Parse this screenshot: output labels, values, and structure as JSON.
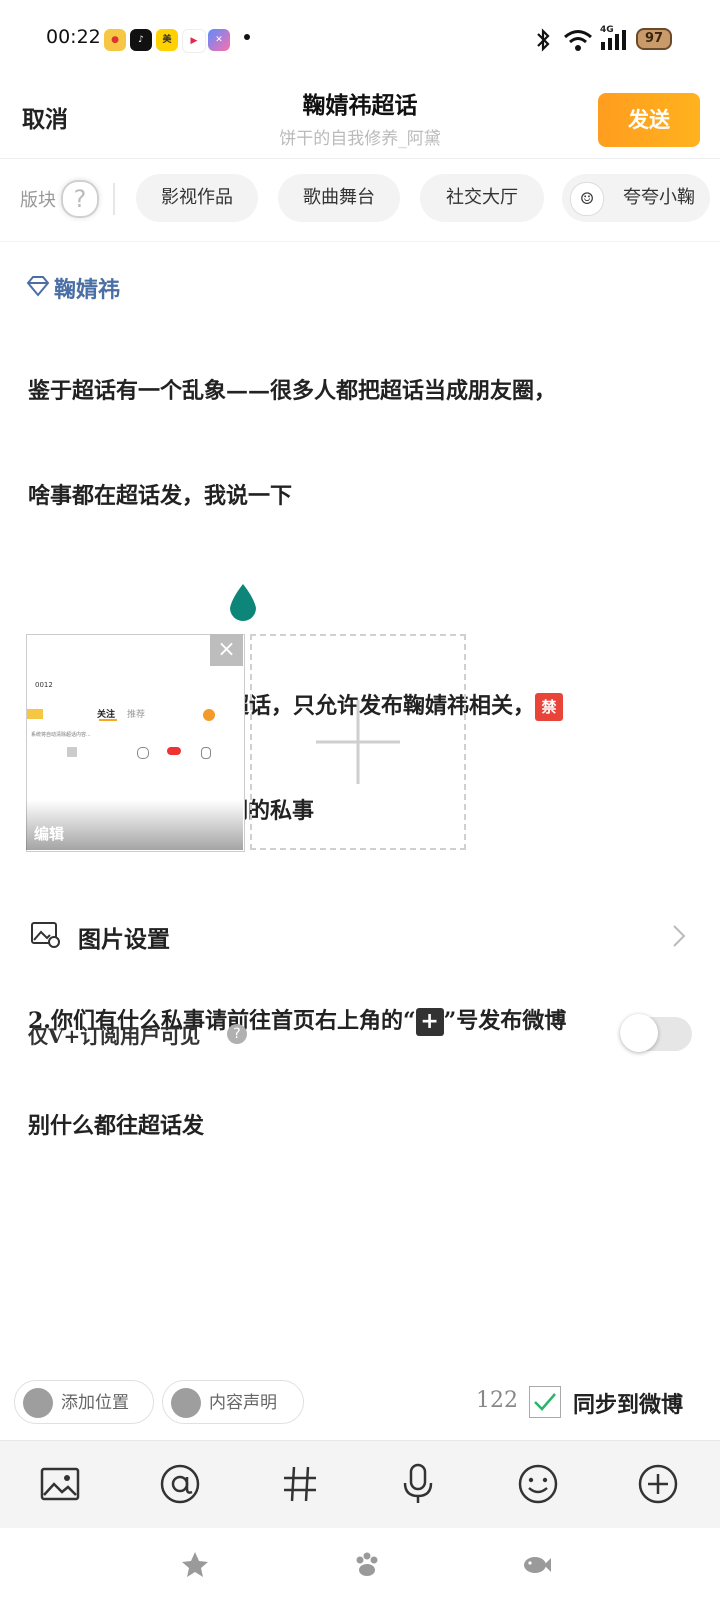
{
  "status_bar": {
    "time": "00:22",
    "app_icons": [
      "weibo-icon",
      "douyin-icon",
      "meituan-icon",
      "video-icon",
      "app-icon"
    ],
    "system_icons": [
      "bluetooth-icon",
      "wifi-icon",
      "4g-signal-icon",
      "battery-icon"
    ],
    "network_label": "4G",
    "battery": "97"
  },
  "header": {
    "cancel_label": "取消",
    "title": "鞠婧祎超话",
    "subtitle": "饼干的自我修养_阿黛",
    "send_label": "发送",
    "accent": "#FF9D1F"
  },
  "sections": {
    "label": "版块",
    "help_glyph": "?",
    "chips": [
      "影视作品",
      "歌曲舞台",
      "社交大厅",
      "夸夸小鞠"
    ]
  },
  "post": {
    "topic_tag": "鞠婧祎",
    "line1": "鉴于超话有一个乱象——很多人都把超话当成朋友圈，",
    "line2": "啥事都在超话发，我说一下",
    "line3_pre": "1.本超话是鞠婧祎主超话，只允许发布鞠婧祎相关，",
    "ban_emoji": "禁",
    "line4": "发其余明星或者是你们的私事",
    "line5_pre": "2.你们有什么私事请前往首页右上角的“",
    "plus_emoji": "+",
    "line5_post": "”号发布微博",
    "line6": "别什么都往超话发"
  },
  "images": {
    "close_glyph": "×",
    "edit_label": "编辑",
    "thumb": {
      "time": "0012",
      "tab_active": "关注",
      "tab_other": "推荐",
      "tip": "系统将自动清除超话内容..."
    }
  },
  "settings": {
    "image_settings_label": "图片设置",
    "vplus_label": "仅V+订阅用户可见",
    "vplus_help": "?",
    "vplus_enabled": false
  },
  "actions": {
    "add_location": "添加位置",
    "content_statement": "内容声明",
    "char_count": "122",
    "sync_label": "同步到微博",
    "sync_checked": true
  },
  "toolbar": {
    "tools": [
      "image-icon",
      "mention-icon",
      "hashtag-icon",
      "microphone-icon",
      "emoji-icon",
      "plus-circle-icon"
    ]
  },
  "navbar": {
    "icons": [
      "star-icon",
      "paw-icon",
      "fish-icon"
    ]
  }
}
